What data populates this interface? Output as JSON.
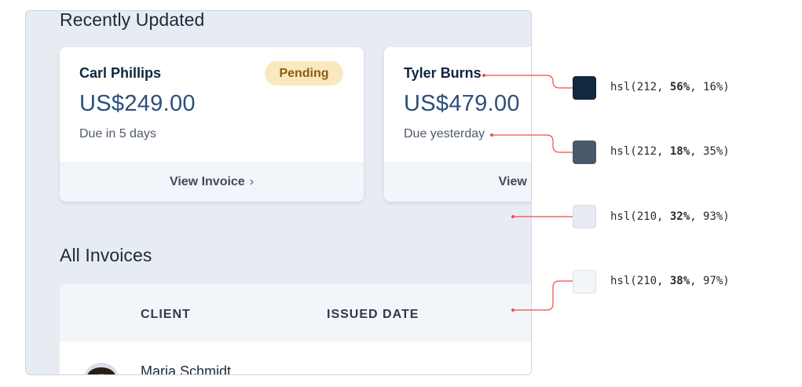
{
  "recently_updated": {
    "title": "Recently Updated",
    "cards": [
      {
        "client": "Carl Phillips",
        "amount": "US$249.00",
        "due": "Due in 5 days",
        "badge": "Pending",
        "action": "View Invoice",
        "action_icon": "chevron-right-icon"
      },
      {
        "client": "Tyler Burns",
        "amount": "US$479.00",
        "due": "Due yesterday",
        "action": "View Invoice"
      }
    ]
  },
  "all_invoices": {
    "title": "All Invoices",
    "columns": [
      "CLIENT",
      "ISSUED DATE"
    ],
    "rows": [
      {
        "client": "Maria Schmidt"
      }
    ]
  },
  "palette": [
    {
      "fn": "hsl(212, ",
      "sat": "56%",
      "light": ", 16%)",
      "color": "#122740"
    },
    {
      "fn": "hsl(212, ",
      "sat": "18%",
      "light": ", 35%)",
      "color": "#4a5869"
    },
    {
      "fn": "hsl(210, ",
      "sat": "32%",
      "light": ", 93%)",
      "color": "#e6ebf1"
    },
    {
      "fn": "hsl(210, ",
      "sat": "38%",
      "light": ", 97%)",
      "color": "#f3f6f9"
    }
  ],
  "colors": {
    "connector": "#ef4b4b",
    "frame_bg": "#e7ecf3",
    "badge_bg": "#f9e9bd",
    "badge_text": "#8d5b12"
  }
}
